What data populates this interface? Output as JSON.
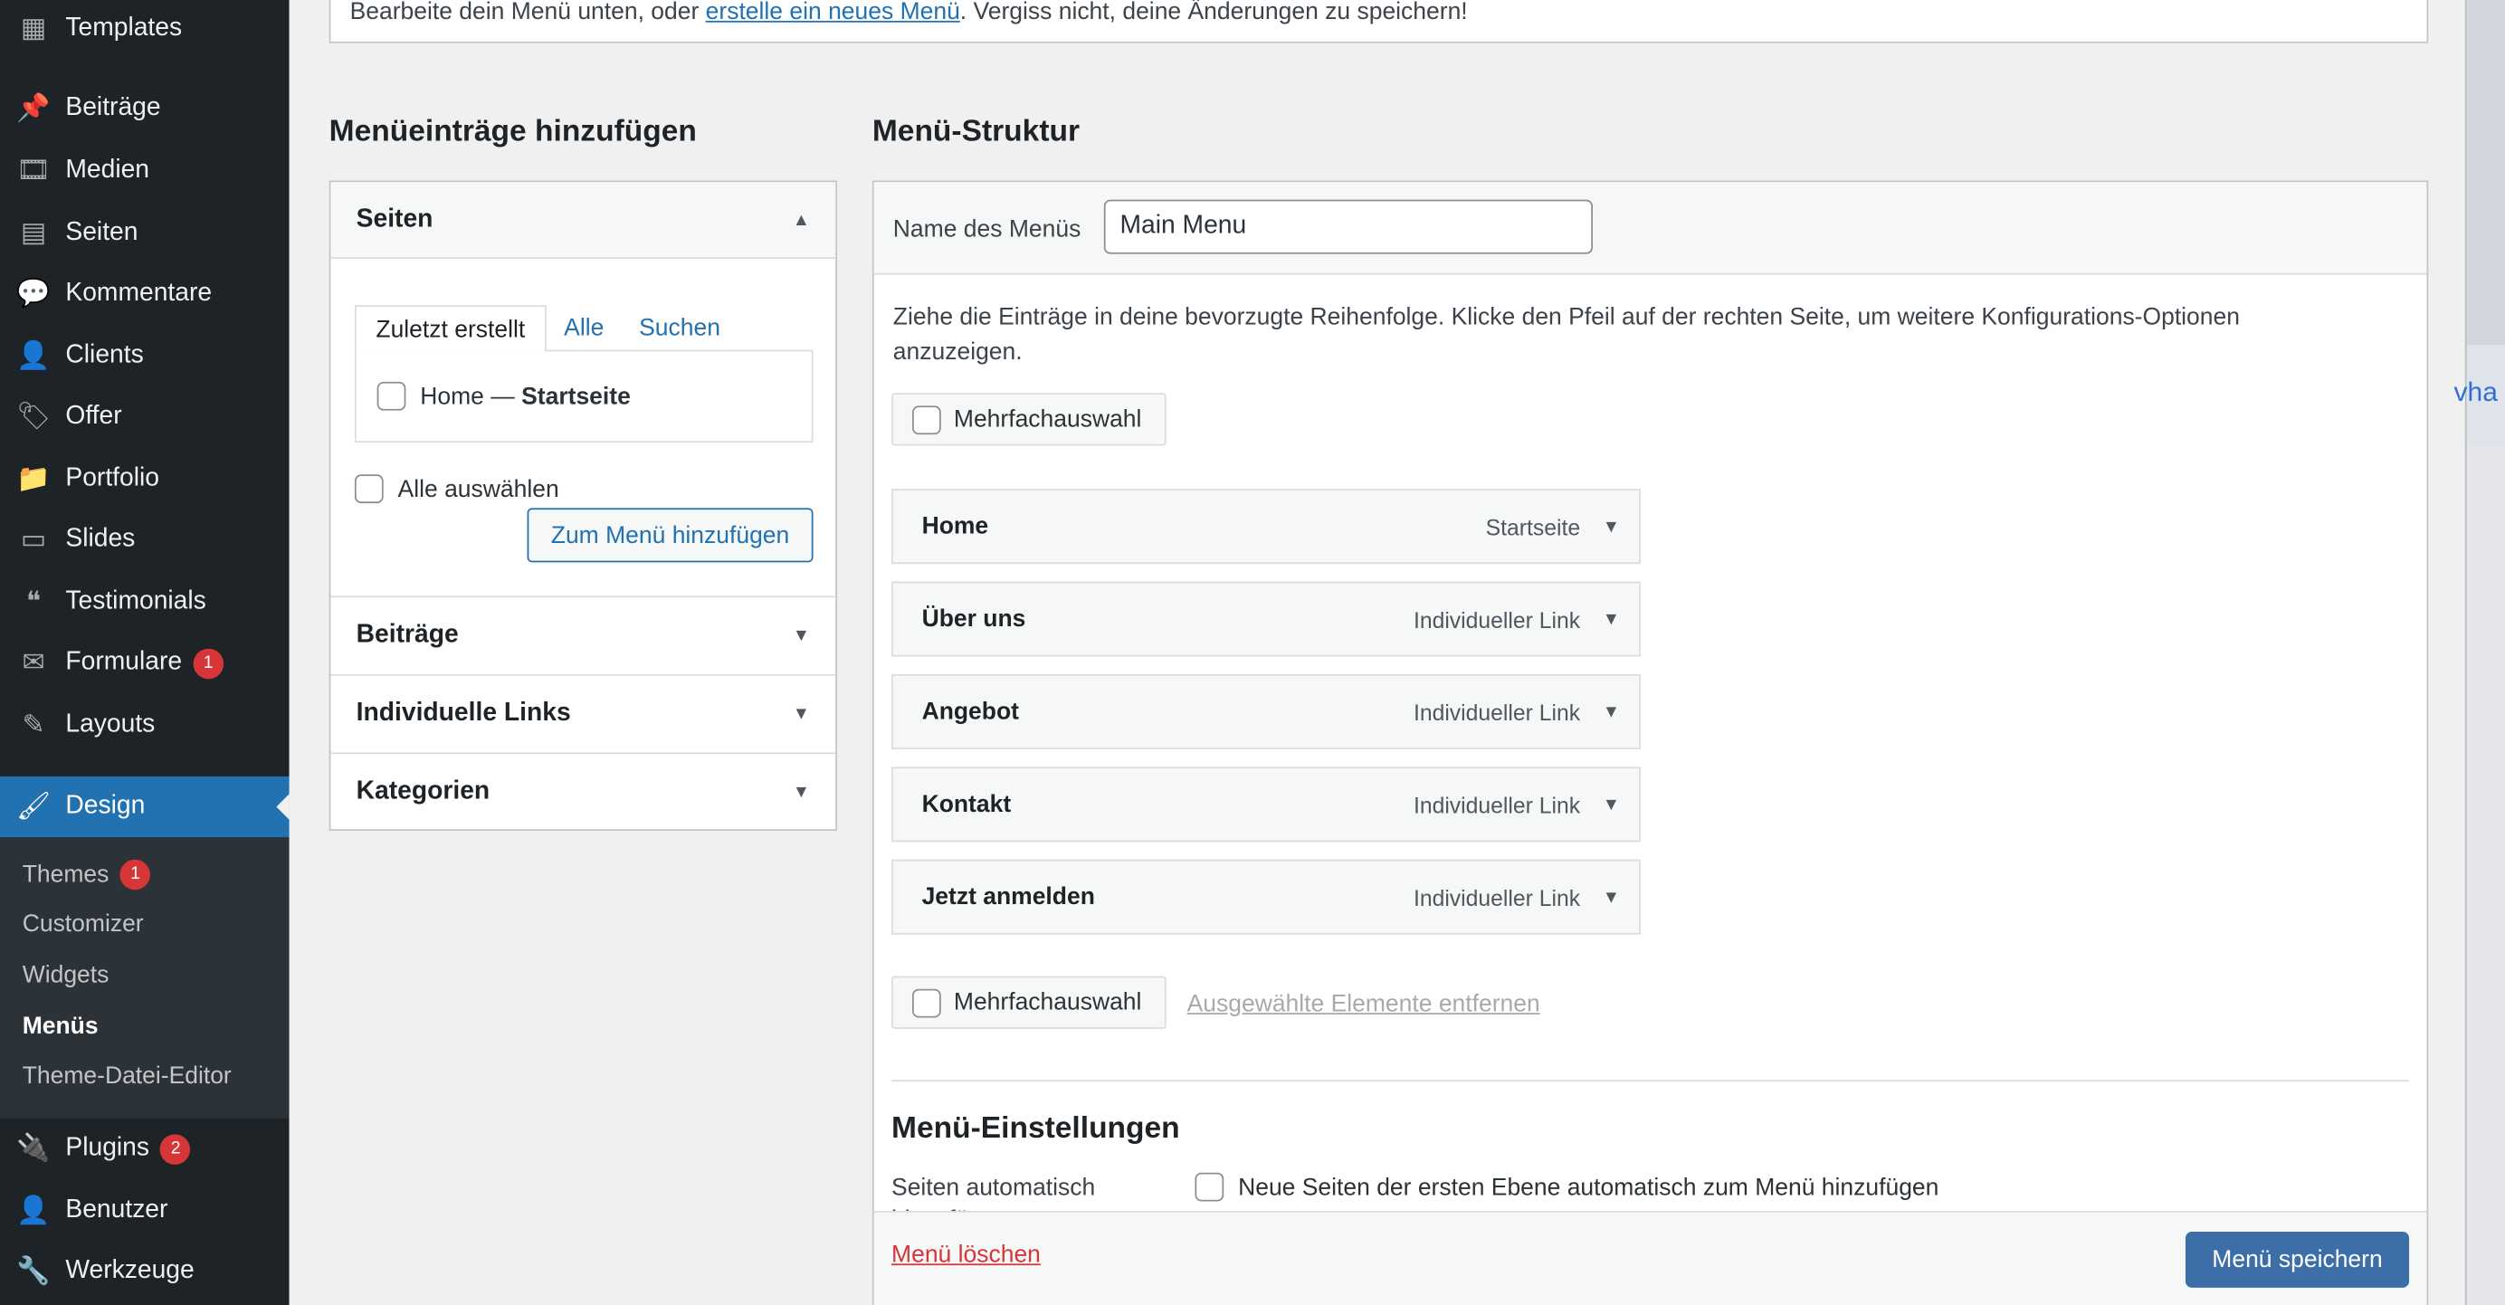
{
  "sidebar": {
    "items": [
      {
        "label": "Templates",
        "icon": "templates-icon",
        "glyph": "▦"
      },
      {
        "label": "Beiträge",
        "icon": "pin-icon",
        "glyph": "📌"
      },
      {
        "label": "Medien",
        "icon": "media-icon",
        "glyph": "🎞"
      },
      {
        "label": "Seiten",
        "icon": "pages-icon",
        "glyph": "▤"
      },
      {
        "label": "Kommentare",
        "icon": "comment-icon",
        "glyph": "💬"
      },
      {
        "label": "Clients",
        "icon": "user-icon",
        "glyph": "👤"
      },
      {
        "label": "Offer",
        "icon": "tag-icon",
        "glyph": "🏷"
      },
      {
        "label": "Portfolio",
        "icon": "folder-icon",
        "glyph": "📁"
      },
      {
        "label": "Slides",
        "icon": "slides-icon",
        "glyph": "▭"
      },
      {
        "label": "Testimonials",
        "icon": "quote-icon",
        "glyph": "❝"
      },
      {
        "label": "Formulare",
        "icon": "mail-icon",
        "glyph": "✉",
        "badge": "1"
      },
      {
        "label": "Layouts",
        "icon": "pencil-icon",
        "glyph": "✎"
      },
      {
        "label": "Design",
        "icon": "brush-icon",
        "glyph": "🖌"
      },
      {
        "label": "Plugins",
        "icon": "plugin-icon",
        "glyph": "🔌",
        "badge": "2"
      },
      {
        "label": "Benutzer",
        "icon": "user-icon",
        "glyph": "👤"
      },
      {
        "label": "Werkzeuge",
        "icon": "wrench-icon",
        "glyph": "🔧"
      }
    ],
    "submenu": [
      {
        "label": "Themes",
        "badge": "1"
      },
      {
        "label": "Customizer"
      },
      {
        "label": "Widgets"
      },
      {
        "label": "Menüs"
      },
      {
        "label": "Theme-Datei-Editor"
      }
    ]
  },
  "notice": {
    "before": "Bearbeite dein Menü unten, oder ",
    "link": "erstelle ein neues Menü",
    "after": ". Vergiss nicht, deine Änderungen zu speichern!"
  },
  "left": {
    "title": "Menüeinträge hinzufügen",
    "pages": {
      "title": "Seiten",
      "tabs": [
        "Zuletzt erstellt",
        "Alle",
        "Suchen"
      ],
      "item_name": "Home",
      "item_dash": " — ",
      "item_state": "Startseite",
      "select_all": "Alle auswählen",
      "add_button": "Zum Menü hinzufügen"
    },
    "sections": [
      "Beiträge",
      "Individuelle Links",
      "Kategorien"
    ]
  },
  "right": {
    "title": "Menü-Struktur",
    "name_label": "Name des Menüs",
    "name_value": "Main Menu",
    "instructions": "Ziehe die Einträge in deine bevorzugte Reihenfolge. Klicke den Pfeil auf der rechten Seite, um weitere Konfigurations-Optionen anzuzeigen.",
    "multi_select": "Mehrfachauswahl",
    "remove_selected": "Ausgewählte Elemente entfernen",
    "items": [
      {
        "title": "Home",
        "type": "Startseite"
      },
      {
        "title": "Über uns",
        "type": "Individueller Link"
      },
      {
        "title": "Angebot",
        "type": "Individueller Link"
      },
      {
        "title": "Kontakt",
        "type": "Individueller Link"
      },
      {
        "title": "Jetzt anmelden",
        "type": "Individueller Link"
      }
    ],
    "settings_title": "Menü-Einstellungen",
    "auto_label": "Seiten automatisch hinzufügen",
    "auto_option": "Neue Seiten der ersten Ebene automatisch zum Menü hinzufügen",
    "delete": "Menü löschen",
    "save": "Menü speichern"
  },
  "background_window": {
    "partial_text": "vha"
  },
  "colors": {
    "sidebar": "#1d2327",
    "accent": "#2271b1",
    "danger": "#d63638",
    "save_button": "#3c6fa7"
  }
}
